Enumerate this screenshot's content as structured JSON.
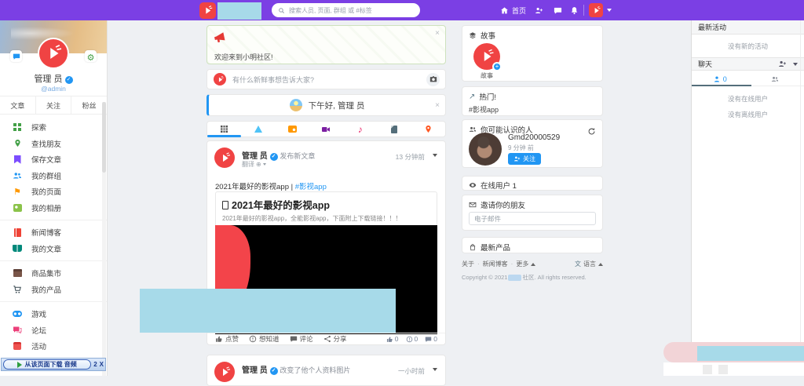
{
  "colors": {
    "navbar_purple": "#7b3fe4",
    "accent_blue": "#2196f3",
    "logo_red": "#f04343",
    "censor_cyan": "#a7dae9"
  },
  "navbar": {
    "search_placeholder": "搜索人员, 页面, 群组 或 #标签",
    "home_label": "首页"
  },
  "sidebar": {
    "name": "管理 员",
    "handle": "@admin",
    "tabs": [
      "文章",
      "关注",
      "粉丝"
    ],
    "menu": [
      "探索",
      "查找朋友",
      "保存文章",
      "我的群组",
      "我的页面",
      "我的相册",
      "新闻博客",
      "我的文章",
      "商品集市",
      "我的产品",
      "游戏",
      "论坛",
      "活动"
    ]
  },
  "download_bar": {
    "label": "从该页面下载 音频",
    "count": "2",
    "close": "X"
  },
  "feed": {
    "welcome_banner": "欢迎来到小明社区!",
    "composer_placeholder": "有什么新鲜事想告诉大家?",
    "greeting": "下午好, 管理 员",
    "post1": {
      "author": "管理 员",
      "action": "发布新文章",
      "translate": "翻译",
      "time": "13 分钟前",
      "text": "2021年最好的影视app | ",
      "hashtag": "#影视app",
      "article_title": "2021年最好的影视app",
      "article_desc": "2021年最好的影视app，全能影视app，下面附上下载链接！！！",
      "actions": [
        "点赞",
        "想知道",
        "评论",
        "分享"
      ],
      "like_count": "0",
      "wonder_count": "0",
      "comment_count": "0"
    },
    "post2": {
      "author": "管理 员",
      "action": "改变了他个人资料图片",
      "time": "一小时前"
    }
  },
  "widgets": {
    "stories": {
      "title": "故事",
      "item_label": "故事"
    },
    "trending": {
      "title": "热门!",
      "tag": "#影视app"
    },
    "suggestions": {
      "title": "你可能认识的人",
      "user": "Gmd20000529",
      "time": "9 分钟 前",
      "follow_label": "关注"
    },
    "online_users": "在线用户 1",
    "invite": {
      "title": "邀请你的朋友",
      "placeholder": "电子邮件"
    },
    "products_title": "最新产品",
    "footer": {
      "links": [
        "关于",
        "新闻博客",
        "更多"
      ],
      "language": "语言",
      "copyright_prefix": "Copyright © 2021",
      "copyright_suffix": "社区. All rights reserved."
    }
  },
  "chat_panel": {
    "activity_title": "最新活动",
    "no_activity": "没有新的活动",
    "chat_title": "聊天",
    "online_tab_count": "0",
    "no_online": "没有在线用户",
    "no_offline": "没有离线用户"
  }
}
